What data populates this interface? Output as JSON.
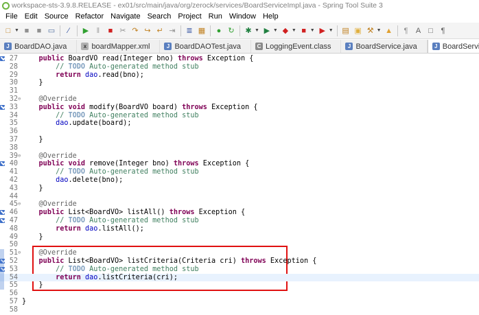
{
  "window": {
    "title": "workspace-sts-3.9.8.RELEASE - ex01/src/main/java/org/zerock/services/BoardServiceImpl.java - Spring Tool Suite 3"
  },
  "menu": [
    "File",
    "Edit",
    "Source",
    "Refactor",
    "Navigate",
    "Search",
    "Project",
    "Run",
    "Window",
    "Help"
  ],
  "toolbar": {
    "icons": [
      {
        "name": "new-icon",
        "glyph": "□",
        "color": "#c08020"
      },
      {
        "name": "save-icon",
        "glyph": "■",
        "color": "#909090"
      },
      {
        "name": "save-all-icon",
        "glyph": "■",
        "color": "#909090"
      },
      {
        "name": "print-icon",
        "glyph": "▭",
        "color": "#5070a0"
      },
      {
        "name": "skip-breakpoints-icon",
        "glyph": "∕",
        "color": "#3050a0"
      },
      {
        "name": "resume-icon",
        "glyph": "▶",
        "color": "#30a030"
      },
      {
        "name": "suspend-icon",
        "glyph": "‖",
        "color": "#a0a0a0"
      },
      {
        "name": "terminate-icon",
        "glyph": "■",
        "color": "#d02020"
      },
      {
        "name": "disconnect-icon",
        "glyph": "✂",
        "color": "#909090"
      },
      {
        "name": "step-into-icon",
        "glyph": "↷",
        "color": "#c08020"
      },
      {
        "name": "step-over-icon",
        "glyph": "↪",
        "color": "#c08020"
      },
      {
        "name": "step-return-icon",
        "glyph": "↵",
        "color": "#c08020"
      },
      {
        "name": "drop-to-frame-icon",
        "glyph": "⇥",
        "color": "#909090"
      },
      {
        "name": "toggle-console-icon",
        "glyph": "≣",
        "color": "#3050a0"
      },
      {
        "name": "open-type-icon",
        "glyph": "▦",
        "color": "#c08020"
      },
      {
        "name": "spring-boot-dashboard-icon",
        "glyph": "●",
        "color": "#30a030"
      },
      {
        "name": "refresh-icon",
        "glyph": "↻",
        "color": "#30a030"
      },
      {
        "name": "debug-icon",
        "glyph": "✱",
        "color": "#208040"
      },
      {
        "name": "run-icon",
        "glyph": "▶",
        "color": "#208040"
      },
      {
        "name": "coverage-icon",
        "glyph": "◆",
        "color": "#d02020"
      },
      {
        "name": "stop-server-icon",
        "glyph": "■",
        "color": "#d02020"
      },
      {
        "name": "external-tools-icon",
        "glyph": "▶",
        "color": "#d02020"
      },
      {
        "name": "new-java-package-icon",
        "glyph": "▤",
        "color": "#c08020"
      },
      {
        "name": "open-folder-icon",
        "glyph": "▣",
        "color": "#e0b040"
      },
      {
        "name": "search-icon",
        "glyph": "⚒",
        "color": "#c08020"
      },
      {
        "name": "open-project-icon",
        "glyph": "▲",
        "color": "#e0a030"
      },
      {
        "name": "toggle-mark-occurrences-icon",
        "glyph": "¶",
        "color": "#909090"
      },
      {
        "name": "toggle-word-wrap-icon",
        "glyph": "A",
        "color": "#606060"
      },
      {
        "name": "block-selection-icon",
        "glyph": "□",
        "color": "#606060"
      },
      {
        "name": "show-whitespace-icon",
        "glyph": "¶",
        "color": "#606060"
      }
    ]
  },
  "tabs": [
    {
      "label": "BoardDAO.java",
      "kind": "java",
      "active": false
    },
    {
      "label": "boardMapper.xml",
      "kind": "xml",
      "active": false
    },
    {
      "label": "BoardDAOTest.java",
      "kind": "java",
      "active": false
    },
    {
      "label": "LoggingEvent.class",
      "kind": "class",
      "active": false
    },
    {
      "label": "BoardService.java",
      "kind": "java",
      "active": false
    },
    {
      "label": "BoardServiceImpl.java",
      "kind": "java",
      "active": true
    }
  ],
  "editor": {
    "lines": [
      {
        "n": "27",
        "fold": "",
        "ann": true,
        "tokens": [
          [
            "",
            "    "
          ],
          [
            "kw",
            "public"
          ],
          [
            "",
            " BoardVO read(Integer bno) "
          ],
          [
            "kw",
            "throws"
          ],
          [
            "",
            " Exception {"
          ]
        ]
      },
      {
        "n": "28",
        "fold": "",
        "ann": false,
        "tokens": [
          [
            "",
            "        "
          ],
          [
            "cm",
            "// "
          ],
          [
            "todo",
            "TODO"
          ],
          [
            "cm",
            " Auto-generated method stub"
          ]
        ]
      },
      {
        "n": "29",
        "fold": "",
        "ann": false,
        "tokens": [
          [
            "",
            "        "
          ],
          [
            "kw",
            "return"
          ],
          [
            "",
            " "
          ],
          [
            "fd",
            "dao"
          ],
          [
            "",
            ".read(bno);"
          ]
        ]
      },
      {
        "n": "30",
        "fold": "",
        "ann": false,
        "tokens": [
          [
            "",
            "    }"
          ]
        ]
      },
      {
        "n": "31",
        "fold": "",
        "ann": false,
        "tokens": [
          [
            "",
            ""
          ]
        ]
      },
      {
        "n": "32",
        "fold": "⊖",
        "ann": false,
        "tokens": [
          [
            "",
            "    "
          ],
          [
            "an",
            "@Override"
          ]
        ]
      },
      {
        "n": "33",
        "fold": "",
        "ann": true,
        "tokens": [
          [
            "",
            "    "
          ],
          [
            "kw",
            "public"
          ],
          [
            "",
            " "
          ],
          [
            "kw",
            "void"
          ],
          [
            "",
            " modify(BoardVO board) "
          ],
          [
            "kw",
            "throws"
          ],
          [
            "",
            " Exception {"
          ]
        ]
      },
      {
        "n": "34",
        "fold": "",
        "ann": false,
        "tokens": [
          [
            "",
            "        "
          ],
          [
            "cm",
            "// "
          ],
          [
            "todo",
            "TODO"
          ],
          [
            "cm",
            " Auto-generated method stub"
          ]
        ]
      },
      {
        "n": "35",
        "fold": "",
        "ann": false,
        "tokens": [
          [
            "",
            "        "
          ],
          [
            "fd",
            "dao"
          ],
          [
            "",
            ".update(board);"
          ]
        ]
      },
      {
        "n": "36",
        "fold": "",
        "ann": false,
        "tokens": [
          [
            "",
            ""
          ]
        ]
      },
      {
        "n": "37",
        "fold": "",
        "ann": false,
        "tokens": [
          [
            "",
            "    }"
          ]
        ]
      },
      {
        "n": "38",
        "fold": "",
        "ann": false,
        "tokens": [
          [
            "",
            ""
          ]
        ]
      },
      {
        "n": "39",
        "fold": "⊖",
        "ann": false,
        "tokens": [
          [
            "",
            "    "
          ],
          [
            "an",
            "@Override"
          ]
        ]
      },
      {
        "n": "40",
        "fold": "",
        "ann": true,
        "tokens": [
          [
            "",
            "    "
          ],
          [
            "kw",
            "public"
          ],
          [
            "",
            " "
          ],
          [
            "kw",
            "void"
          ],
          [
            "",
            " remove(Integer bno) "
          ],
          [
            "kw",
            "throws"
          ],
          [
            "",
            " Exception {"
          ]
        ]
      },
      {
        "n": "41",
        "fold": "",
        "ann": false,
        "tokens": [
          [
            "",
            "        "
          ],
          [
            "cm",
            "// "
          ],
          [
            "todo",
            "TODO"
          ],
          [
            "cm",
            " Auto-generated method stub"
          ]
        ]
      },
      {
        "n": "42",
        "fold": "",
        "ann": false,
        "tokens": [
          [
            "",
            "        "
          ],
          [
            "fd",
            "dao"
          ],
          [
            "",
            ".delete(bno);"
          ]
        ]
      },
      {
        "n": "43",
        "fold": "",
        "ann": false,
        "tokens": [
          [
            "",
            "    }"
          ]
        ]
      },
      {
        "n": "44",
        "fold": "",
        "ann": false,
        "tokens": [
          [
            "",
            ""
          ]
        ]
      },
      {
        "n": "45",
        "fold": "⊖",
        "ann": false,
        "tokens": [
          [
            "",
            "    "
          ],
          [
            "an",
            "@Override"
          ]
        ]
      },
      {
        "n": "46",
        "fold": "",
        "ann": true,
        "tokens": [
          [
            "",
            "    "
          ],
          [
            "kw",
            "public"
          ],
          [
            "",
            " List<BoardVO> listAll() "
          ],
          [
            "kw",
            "throws"
          ],
          [
            "",
            " Exception {"
          ]
        ]
      },
      {
        "n": "47",
        "fold": "",
        "ann": true,
        "tokens": [
          [
            "",
            "        "
          ],
          [
            "cm",
            "// "
          ],
          [
            "todo",
            "TODO"
          ],
          [
            "cm",
            " Auto-generated method stub"
          ]
        ]
      },
      {
        "n": "48",
        "fold": "",
        "ann": false,
        "tokens": [
          [
            "",
            "        "
          ],
          [
            "kw",
            "return"
          ],
          [
            "",
            " "
          ],
          [
            "fd",
            "dao"
          ],
          [
            "",
            ".listAll();"
          ]
        ]
      },
      {
        "n": "49",
        "fold": "",
        "ann": false,
        "tokens": [
          [
            "",
            "    }"
          ]
        ]
      },
      {
        "n": "50",
        "fold": "",
        "ann": false,
        "tokens": [
          [
            "",
            ""
          ]
        ]
      },
      {
        "n": "51",
        "fold": "⊖",
        "ann": false,
        "tokens": [
          [
            "",
            "    "
          ],
          [
            "an",
            "@Override"
          ]
        ]
      },
      {
        "n": "52",
        "fold": "",
        "ann": true,
        "tokens": [
          [
            "",
            "    "
          ],
          [
            "kw",
            "public"
          ],
          [
            "",
            " List<BoardVO> listCriteria(Criteria cri) "
          ],
          [
            "kw",
            "throws"
          ],
          [
            "",
            " Exception {"
          ]
        ]
      },
      {
        "n": "53",
        "fold": "",
        "ann": true,
        "tokens": [
          [
            "",
            "        "
          ],
          [
            "cm",
            "// "
          ],
          [
            "todo",
            "TODO"
          ],
          [
            "cm",
            " Auto-generated method stub"
          ]
        ]
      },
      {
        "n": "54",
        "fold": "",
        "ann": false,
        "current": true,
        "tokens": [
          [
            "",
            "        "
          ],
          [
            "kw",
            "return"
          ],
          [
            "",
            " "
          ],
          [
            "fd",
            "dao"
          ],
          [
            "",
            ".listCriteria(cri);"
          ]
        ]
      },
      {
        "n": "55",
        "fold": "",
        "ann": false,
        "tokens": [
          [
            "",
            "    }"
          ]
        ]
      },
      {
        "n": "56",
        "fold": "",
        "ann": false,
        "tokens": [
          [
            "",
            ""
          ]
        ]
      },
      {
        "n": "57",
        "fold": "",
        "ann": false,
        "tokens": [
          [
            "",
            "}"
          ]
        ]
      },
      {
        "n": "58",
        "fold": "",
        "ann": false,
        "tokens": [
          [
            "",
            ""
          ]
        ]
      }
    ],
    "modified_range_color": "#4a7fd0"
  }
}
